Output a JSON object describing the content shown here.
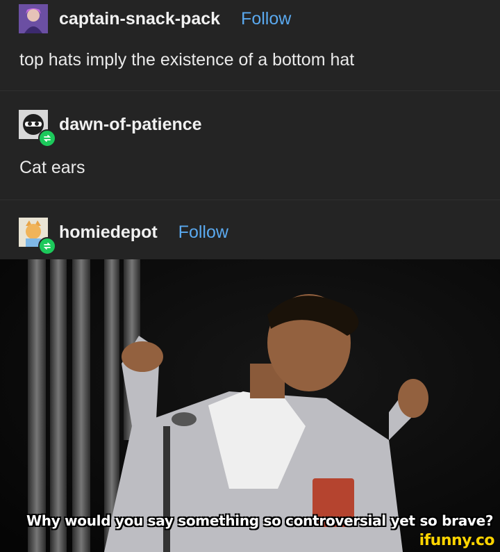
{
  "posts": [
    {
      "username": "captain-snack-pack",
      "follow_label": "Follow",
      "text": "top hats imply the existence of a bottom hat"
    },
    {
      "username": "dawn-of-patience",
      "text": "Cat ears",
      "reblog": true
    },
    {
      "username": "homiedepot",
      "follow_label": "Follow",
      "reblog": true
    }
  ],
  "gif": {
    "caption": "Why would you say something so controversial yet so brave?"
  },
  "watermark": "ifunny.co",
  "colors": {
    "background": "#242424",
    "follow": "#5aa9ef",
    "reblog_badge": "#1cc95b",
    "watermark": "#ffd400"
  }
}
